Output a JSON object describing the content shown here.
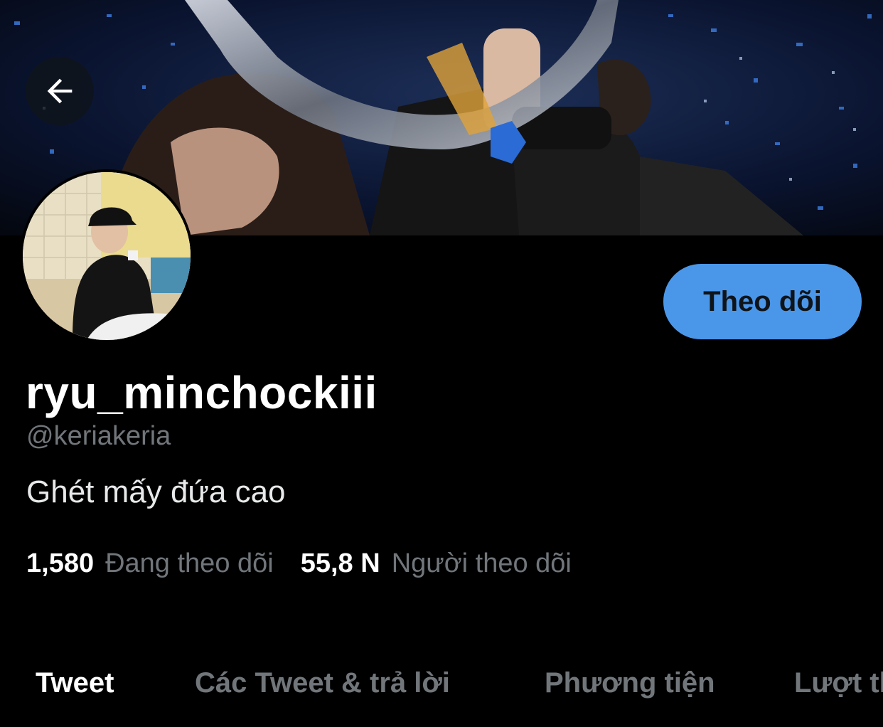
{
  "header": {
    "back_icon": "arrow-left-icon",
    "banner_description_colors": {
      "background": "#0b1224",
      "accent": "#2b6bd6"
    }
  },
  "profile": {
    "display_name": "ryu_minchockiii",
    "handle": "@keriakeria",
    "bio": "Ghét mấy đứa cao",
    "follow_label": "Theo dõi",
    "following_count": "1,580",
    "following_label": "Đang theo dõi",
    "followers_count": "55,8 N",
    "followers_label": "Người theo dõi"
  },
  "tabs": [
    {
      "label": "Tweet",
      "active": true
    },
    {
      "label": "Các Tweet & trả lời",
      "active": false
    },
    {
      "label": "Phương tiện",
      "active": false
    },
    {
      "label": "Lượt thích",
      "active": false
    }
  ],
  "colors": {
    "accent": "#4a97ea",
    "background": "#000000",
    "secondary_text": "#71767b",
    "primary_text": "#ffffff"
  }
}
